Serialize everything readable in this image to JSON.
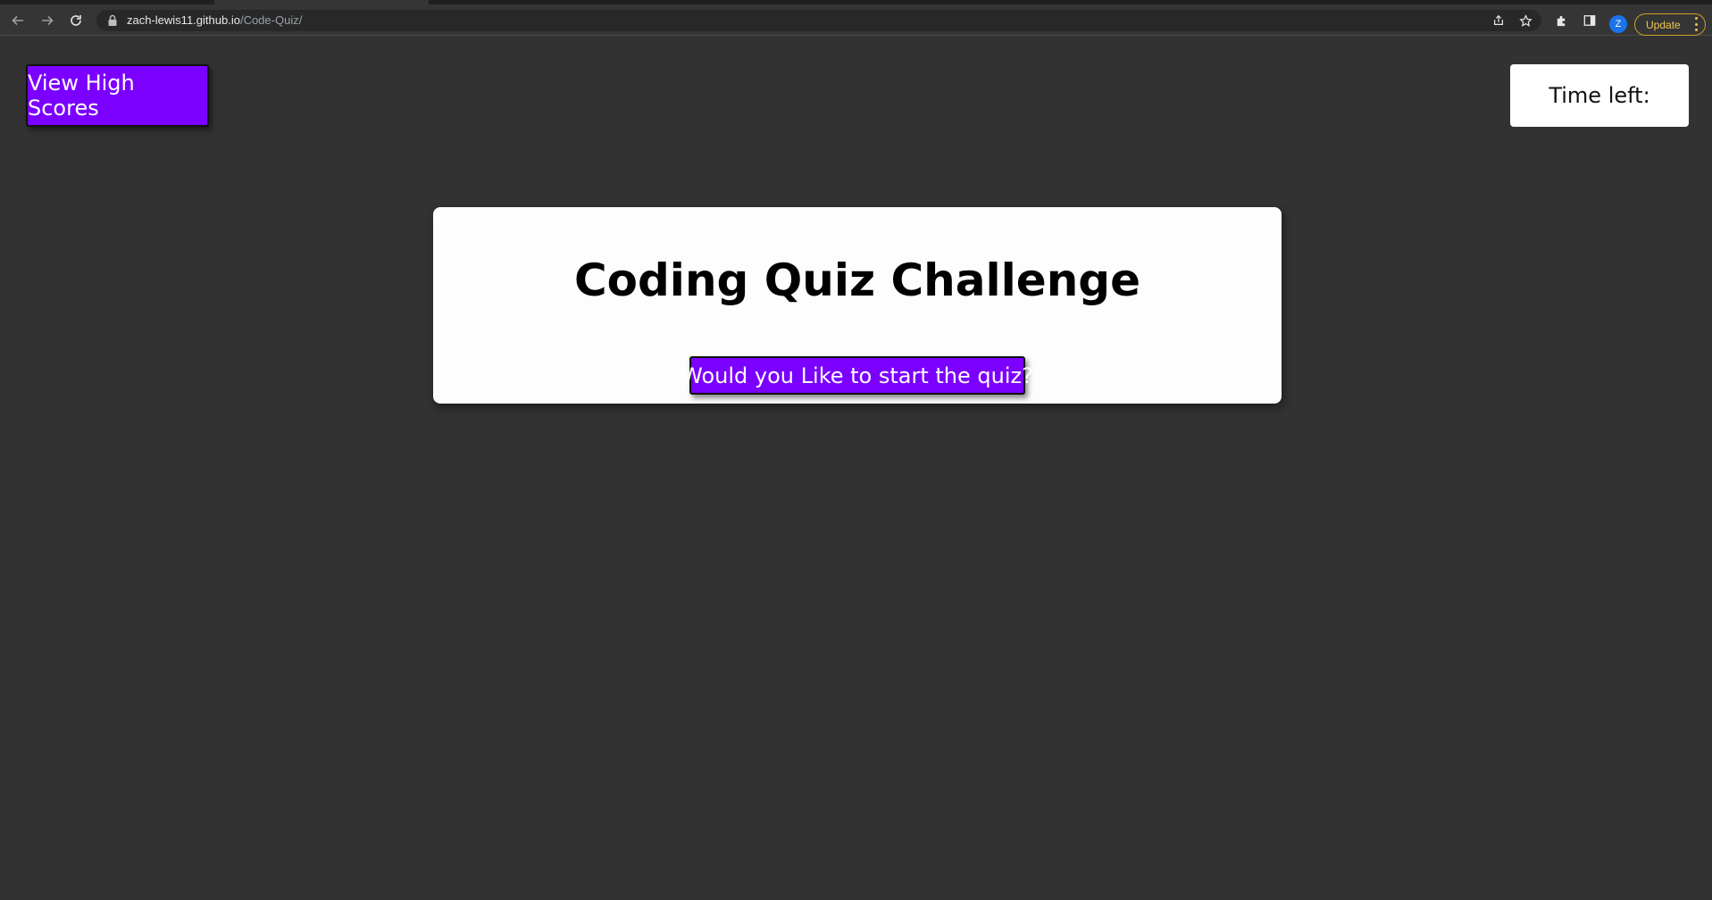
{
  "browser": {
    "url_host": "zach-lewis11.github.io",
    "url_path": "/Code-Quiz/",
    "profile_initial": "Z",
    "update_label": "Update",
    "icons": [
      "back-icon",
      "forward-icon",
      "reload-icon",
      "lock-icon",
      "share-icon",
      "star-icon",
      "extensions-icon",
      "side-panel-icon",
      "kebab-menu-icon"
    ]
  },
  "header": {
    "high_scores_label": "View High Scores",
    "timer_label": "Time left:"
  },
  "main": {
    "title": "Coding Quiz Challenge",
    "start_label": "Would you Like to start the quiz?"
  },
  "colors": {
    "background": "#323232",
    "accent": "#7b00ff",
    "card": "#fdfdfd"
  }
}
